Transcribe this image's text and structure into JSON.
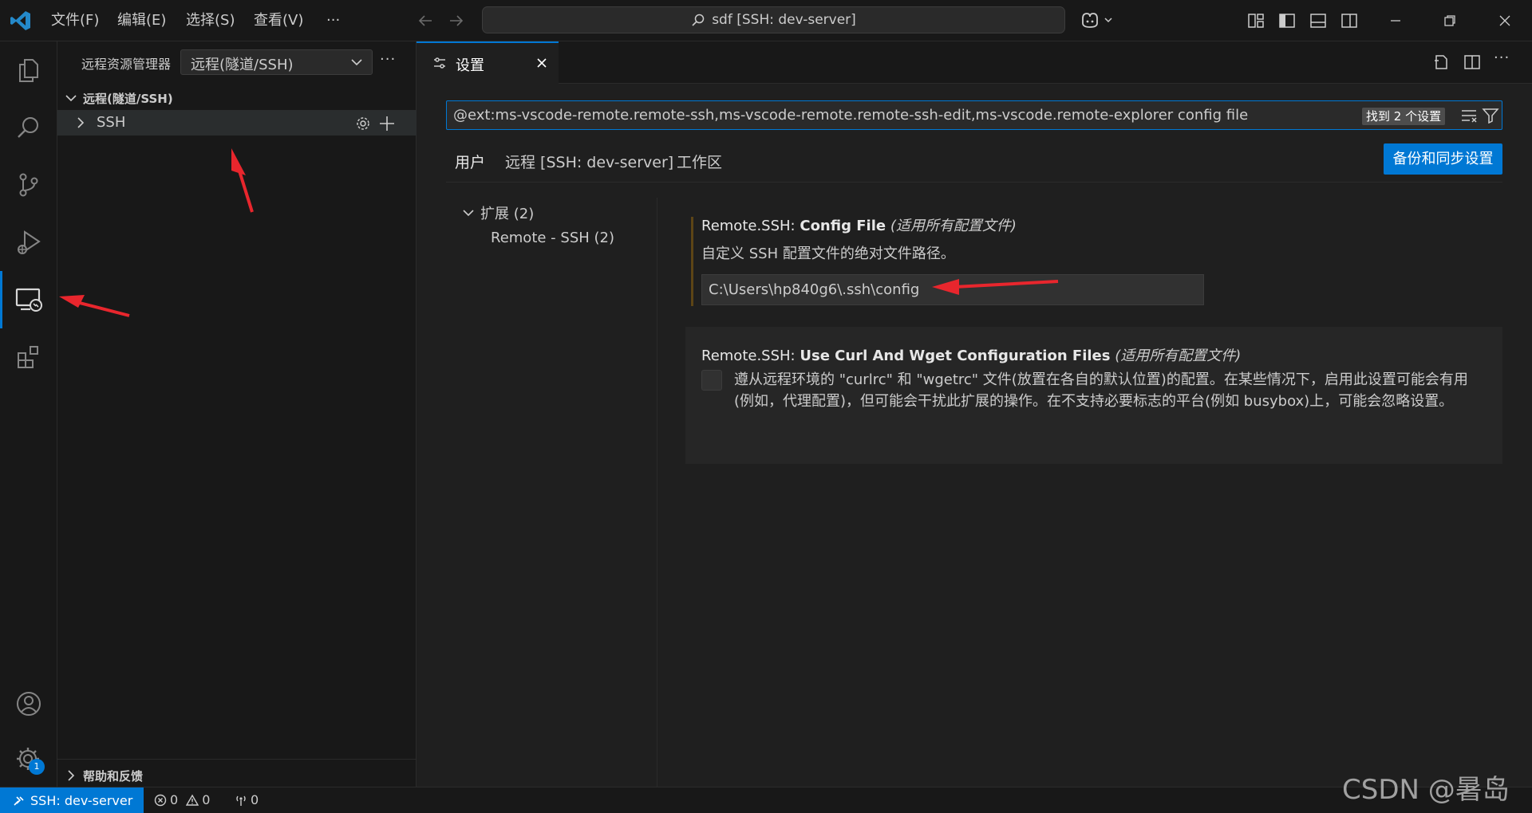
{
  "titlebar": {
    "menu": [
      "文件(F)",
      "编辑(E)",
      "选择(S)",
      "查看(V)",
      "···"
    ],
    "command_center": "sdf [SSH: dev-server]"
  },
  "activity": {
    "items": [
      "explorer-icon",
      "search-icon",
      "source-control-icon",
      "run-debug-icon",
      "remote-explorer-icon",
      "extensions-icon"
    ],
    "bottom": [
      "accounts-icon",
      "manage-gear-icon"
    ],
    "badge": "1"
  },
  "sidebar": {
    "title": "远程资源管理器",
    "dropdown_value": "远程(隧道/SSH)",
    "section_title": "远程(隧道/SSH)",
    "tree_item": "SSH",
    "footer_section": "帮助和反馈"
  },
  "editor": {
    "tab_label": "设置",
    "search_value": "@ext:ms-vscode-remote.remote-ssh,ms-vscode-remote.remote-ssh-edit,ms-vscode.remote-explorer config file",
    "found_badge": "找到 2 个设置",
    "scope_tabs": [
      "用户",
      "远程 [SSH: dev-server]",
      "工作区"
    ],
    "sync_button": "备份和同步设置",
    "toc": {
      "group": "扩展 (2)",
      "item": "Remote - SSH (2)"
    },
    "setting1": {
      "category": "Remote.SSH: ",
      "name": "Config File",
      "scope": "(适用所有配置文件)",
      "description": "自定义 SSH 配置文件的绝对文件路径。",
      "value": "C:\\Users\\hp840g6\\.ssh\\config"
    },
    "setting2": {
      "category": "Remote.SSH: ",
      "name": "Use Curl And Wget Configuration Files",
      "scope": "(适用所有配置文件)",
      "description": "遵从远程环境的 \"curlrc\" 和 \"wgetrc\" 文件(放置在各自的默认位置)的配置。在某些情况下，启用此设置可能会有用(例如，代理配置)，但可能会干扰此扩展的操作。在不支持必要标志的平台(例如 busybox)上，可能会忽略设置。",
      "checked": false
    }
  },
  "statusbar": {
    "remote": "SSH: dev-server",
    "errors": "0",
    "warnings": "0",
    "ports": "0"
  },
  "watermark": "CSDN @暑岛",
  "colors": {
    "accent": "#0078d4",
    "arrow": "#e8262d",
    "modified_bar": "#bb800966"
  }
}
